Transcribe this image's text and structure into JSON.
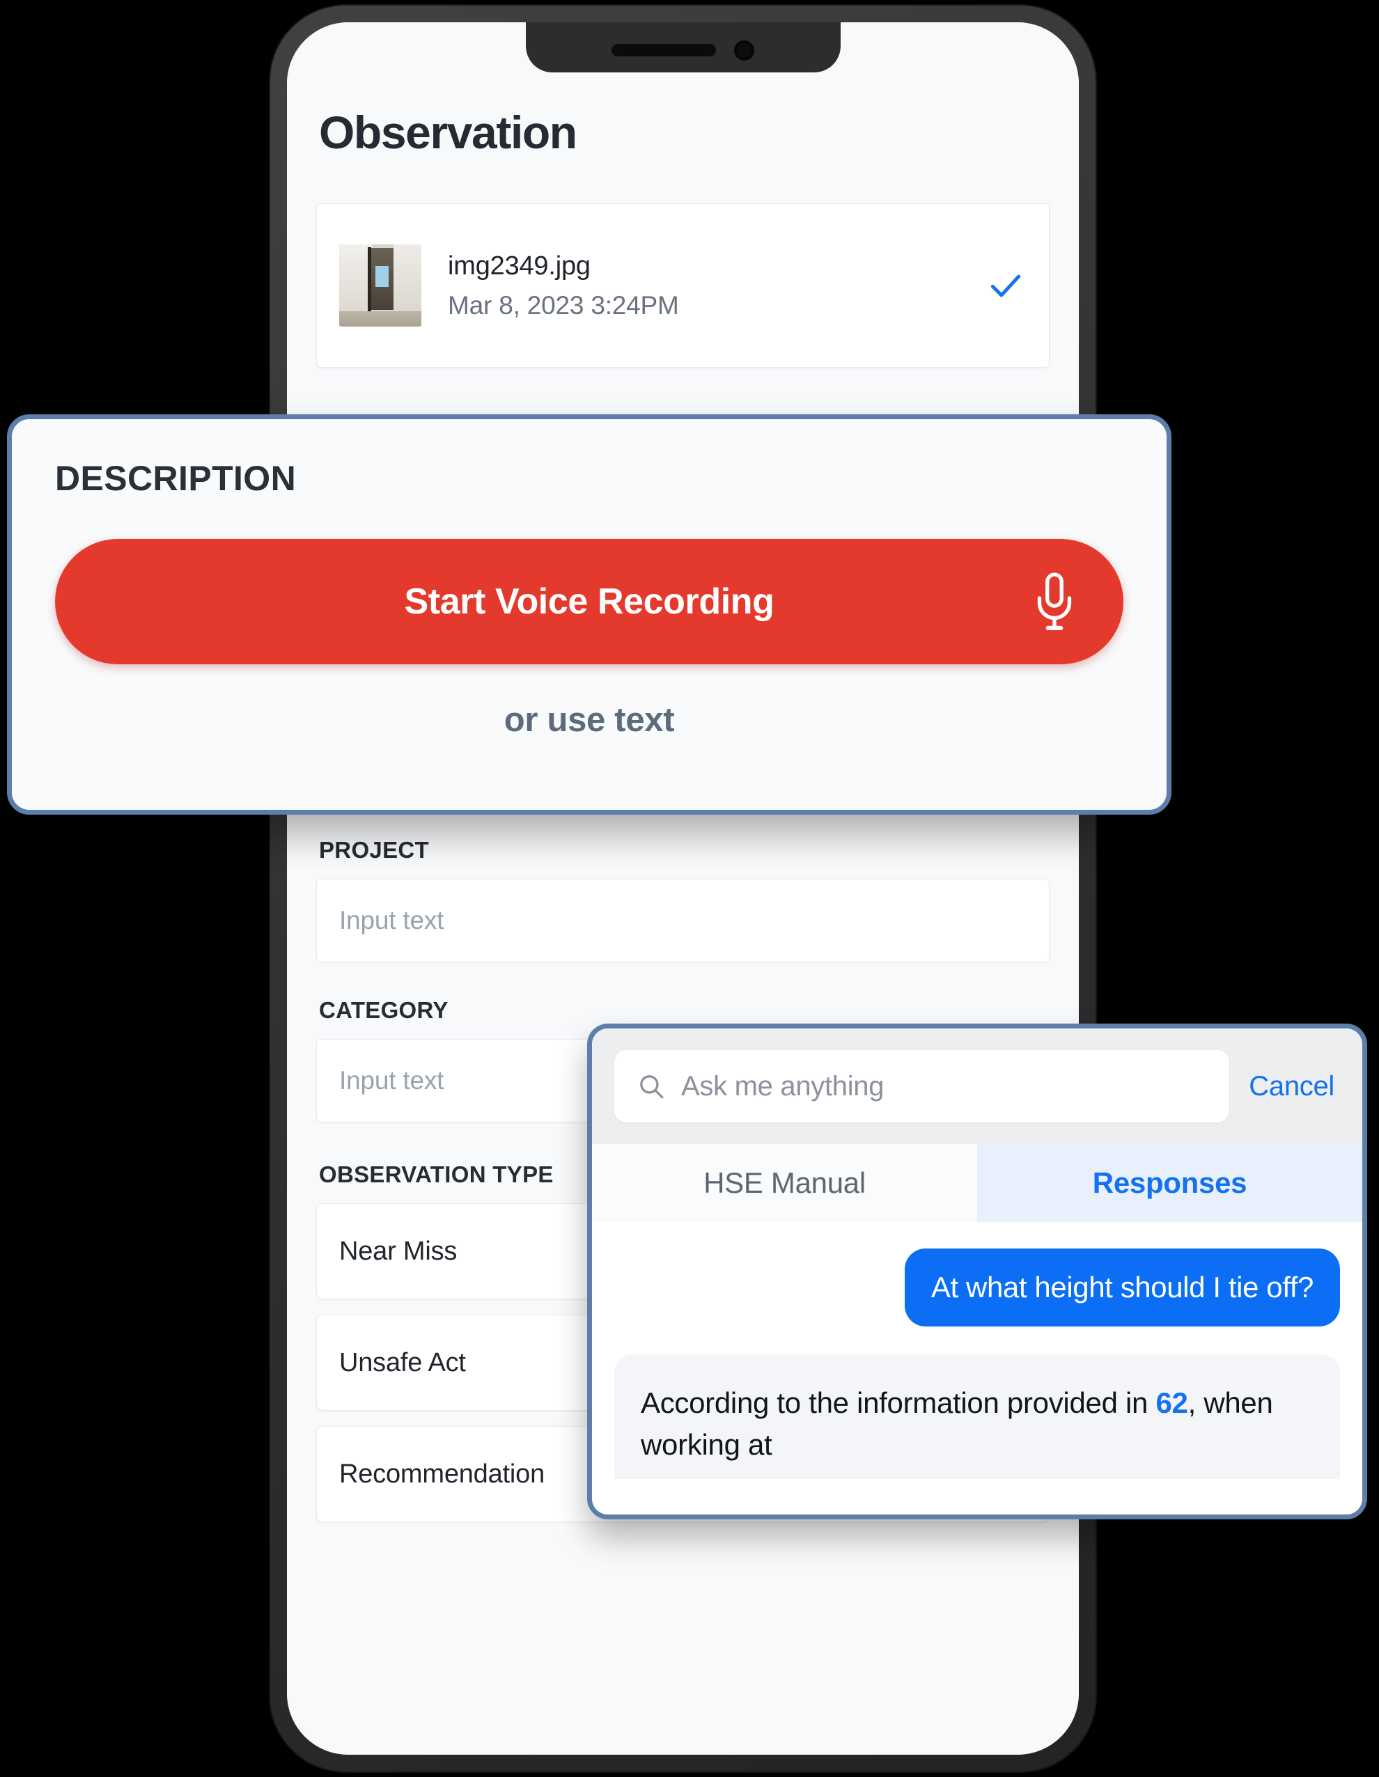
{
  "colors": {
    "accent_red": "#e43a2d",
    "accent_blue": "#1471ef",
    "panel_border": "#5b7faa",
    "bubble_blue": "#0b6ef4",
    "screen_bg": "#f8f9fb",
    "page_bg": "#000000"
  },
  "phone": {
    "notch_speaker_icon": "speaker-grille-icon",
    "notch_camera_icon": "front-camera-icon"
  },
  "screen": {
    "page_title": "Observation",
    "file_card": {
      "thumbnail_icon": "photo-thumbnail",
      "file_name": "img2349.jpg",
      "file_date": "Mar 8, 2023 3:24PM",
      "status_icon": "checkmark-icon"
    },
    "description_textarea": {
      "value": "",
      "placeholder": ""
    },
    "fields": [
      {
        "label": "PROJECT",
        "value": "",
        "placeholder": "Input text"
      },
      {
        "label": "CATEGORY",
        "value": "",
        "placeholder": "Input text"
      }
    ],
    "observation_type": {
      "label": "OBSERVATION TYPE",
      "options": [
        {
          "label": "Near Miss",
          "selected": false
        },
        {
          "label": "Unsafe Act",
          "selected": true
        },
        {
          "label": "Recommendation",
          "selected": false
        }
      ]
    }
  },
  "description_panel": {
    "heading": "DESCRIPTION",
    "record_button_label": "Start Voice Recording",
    "record_button_icon": "microphone-icon",
    "alt_text": "or use text"
  },
  "chat_panel": {
    "search": {
      "icon": "search-icon",
      "value": "",
      "placeholder": "Ask me anything"
    },
    "cancel_label": "Cancel",
    "tabs": [
      {
        "label": "HSE Manual",
        "active": false
      },
      {
        "label": "Responses",
        "active": true
      }
    ],
    "messages": [
      {
        "role": "user",
        "text": "At what height should I tie off?"
      },
      {
        "role": "assistant",
        "prefix": "According to the information provided in ",
        "reference": "62",
        "suffix": ", when working at"
      }
    ]
  }
}
